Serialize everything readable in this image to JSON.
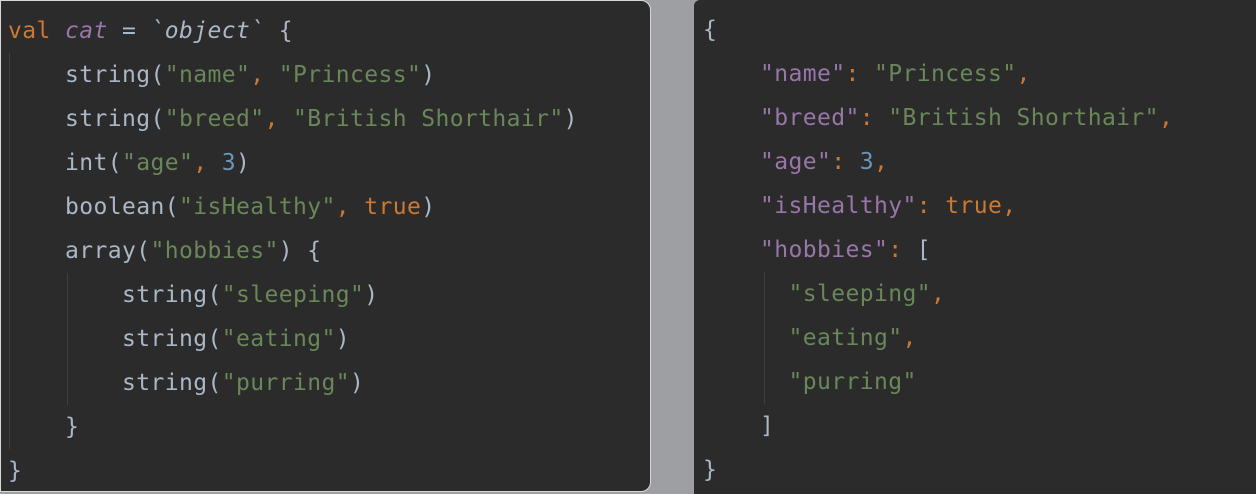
{
  "kotlin": {
    "l1": {
      "kw_val": "val",
      "var_name": "cat",
      "eq": " = ",
      "tick_open": "`",
      "func": "object",
      "tick_close": "`",
      "brace": " {"
    },
    "l2": {
      "fn": "string",
      "p1": "(",
      "a1": "\"name\"",
      "comma": ", ",
      "a2": "\"Princess\"",
      "p2": ")"
    },
    "l3": {
      "fn": "string",
      "p1": "(",
      "a1": "\"breed\"",
      "comma": ", ",
      "a2": "\"British Shorthair\"",
      "p2": ")"
    },
    "l4": {
      "fn": "int",
      "p1": "(",
      "a1": "\"age\"",
      "comma": ", ",
      "a2": "3",
      "p2": ")"
    },
    "l5": {
      "fn": "boolean",
      "p1": "(",
      "a1": "\"isHealthy\"",
      "comma": ", ",
      "a2": "true",
      "p2": ")"
    },
    "l6": {
      "fn": "array",
      "p1": "(",
      "a1": "\"hobbies\"",
      "p2": ") {"
    },
    "l7": {
      "fn": "string",
      "p1": "(",
      "a1": "\"sleeping\"",
      "p2": ")"
    },
    "l8": {
      "fn": "string",
      "p1": "(",
      "a1": "\"eating\"",
      "p2": ")"
    },
    "l9": {
      "fn": "string",
      "p1": "(",
      "a1": "\"purring\"",
      "p2": ")"
    },
    "l10": {
      "brace": "}"
    },
    "l11": {
      "brace": "}"
    }
  },
  "json": {
    "open_brace": "{",
    "name": {
      "key": "\"name\"",
      "colon": ": ",
      "value": "\"Princess\"",
      "comma": ","
    },
    "breed": {
      "key": "\"breed\"",
      "colon": ": ",
      "value": "\"British Shorthair\"",
      "comma": ","
    },
    "age": {
      "key": "\"age\"",
      "colon": ": ",
      "value": "3",
      "comma": ","
    },
    "isHealthy": {
      "key": "\"isHealthy\"",
      "colon": ": ",
      "value": "true",
      "comma": ","
    },
    "hobbies": {
      "key": "\"hobbies\"",
      "colon": ": ",
      "open": "["
    },
    "h1": {
      "value": "\"sleeping\"",
      "comma": ","
    },
    "h2": {
      "value": "\"eating\"",
      "comma": ","
    },
    "h3": {
      "value": "\"purring\""
    },
    "close_bracket": "]",
    "close_brace": "}"
  },
  "colors": {
    "background": "#2b2b2b",
    "keyword": "#cc7832",
    "string": "#6a8759",
    "number": "#6897bb",
    "property": "#9876aa",
    "text": "#a9b7c6"
  }
}
